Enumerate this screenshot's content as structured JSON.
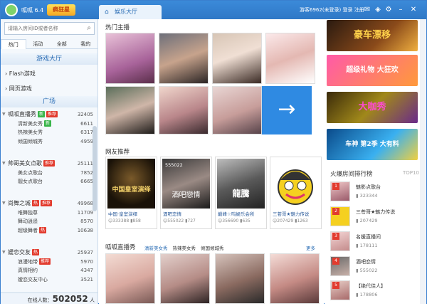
{
  "app": {
    "name": "呱呱 6.4",
    "promo": "疯狂星",
    "tab": "娱乐大厅",
    "user": "游客6962(未登录)",
    "login": "登录",
    "register": "注册"
  },
  "search": {
    "placeholder": "请输入房间ID或者名称"
  },
  "sidebar_tabs": [
    "热门",
    "活动",
    "全部",
    "我的"
  ],
  "sections": {
    "game_hall": "游戏大厅",
    "plaza": "广场"
  },
  "links": [
    "Flash游戏",
    "网页游戏"
  ],
  "groups": [
    {
      "name": "呱呱直播秀",
      "badges": [
        "新",
        "推荐"
      ],
      "count": "32405",
      "items": [
        {
          "name": "清新美女秀",
          "badge": "新",
          "count": "6611"
        },
        {
          "name": "热辣美女秀",
          "count": "6317"
        },
        {
          "name": "倾国倾城秀",
          "count": "4959"
        }
      ]
    },
    {
      "name": "帅哥美女点歌",
      "badges": [
        "推荐"
      ],
      "count": "25111",
      "items": [
        {
          "name": "美女点歌台",
          "count": "7852"
        },
        {
          "name": "靓女点歌台",
          "count": "6665"
        }
      ]
    },
    {
      "name": "尚舞之城",
      "badges": [
        "热",
        "推荐"
      ],
      "count": "49968",
      "items": [
        {
          "name": "唯舞独尊",
          "count": "11709"
        },
        {
          "name": "舞动逍遥",
          "count": "8570"
        },
        {
          "name": "超级舞者",
          "badge": "热",
          "count": "10638"
        }
      ]
    },
    {
      "name": "嫒恋交友",
      "badges": [
        "热"
      ],
      "count": "25937",
      "items": [
        {
          "name": "浪漫地带",
          "badge": "推荐",
          "count": "5970"
        },
        {
          "name": "真情相约",
          "count": "4347"
        },
        {
          "name": "嫒恋交友中心",
          "count": "3521"
        }
      ]
    }
  ],
  "online": {
    "label": "在线人数：",
    "count": "502052",
    "unit": "人"
  },
  "main": {
    "hot_title": "热门主播",
    "net_title": "网友推荐",
    "show_title": "呱呱直播秀",
    "show_tabs": [
      "清新美女秀",
      "热辣美女秀",
      "倾国倾城秀"
    ],
    "more": "更多",
    "net_cards": [
      {
        "title": "中国·皇室演绎",
        "fans": "333388",
        "online": "858",
        "overlay": "中国皇室演绎"
      },
      {
        "title": "酒吧恋情",
        "fans": "555022",
        "online": "727",
        "overlay": "酒吧戀情",
        "code": "555022"
      },
      {
        "title": "巅峰☆呜娱乐会所",
        "fans": "356690",
        "online": "635",
        "overlay": "龍騰"
      },
      {
        "title": "三苍哥★魅力传说",
        "fans": "207429",
        "online": "1263",
        "overlay": ""
      }
    ]
  },
  "banners": [
    "豪车漂移",
    "超级礼物 大狂欢",
    "大咖秀",
    "车神 第2季 大有料"
  ],
  "ranking": {
    "title": "火爆房间排行榜",
    "num_label": "TOP10",
    "items": [
      {
        "rank": "1",
        "name": "魅影点歌台",
        "views": "323344"
      },
      {
        "rank": "2",
        "name": "三苍哥★魅力传说",
        "views": "207429"
      },
      {
        "rank": "3",
        "name": "名媛直播间",
        "views": "178111"
      },
      {
        "rank": "4",
        "name": "酒吧恋情",
        "views": "555022"
      },
      {
        "rank": "5",
        "name": "【绝代佳人】",
        "views": "178806"
      }
    ]
  }
}
